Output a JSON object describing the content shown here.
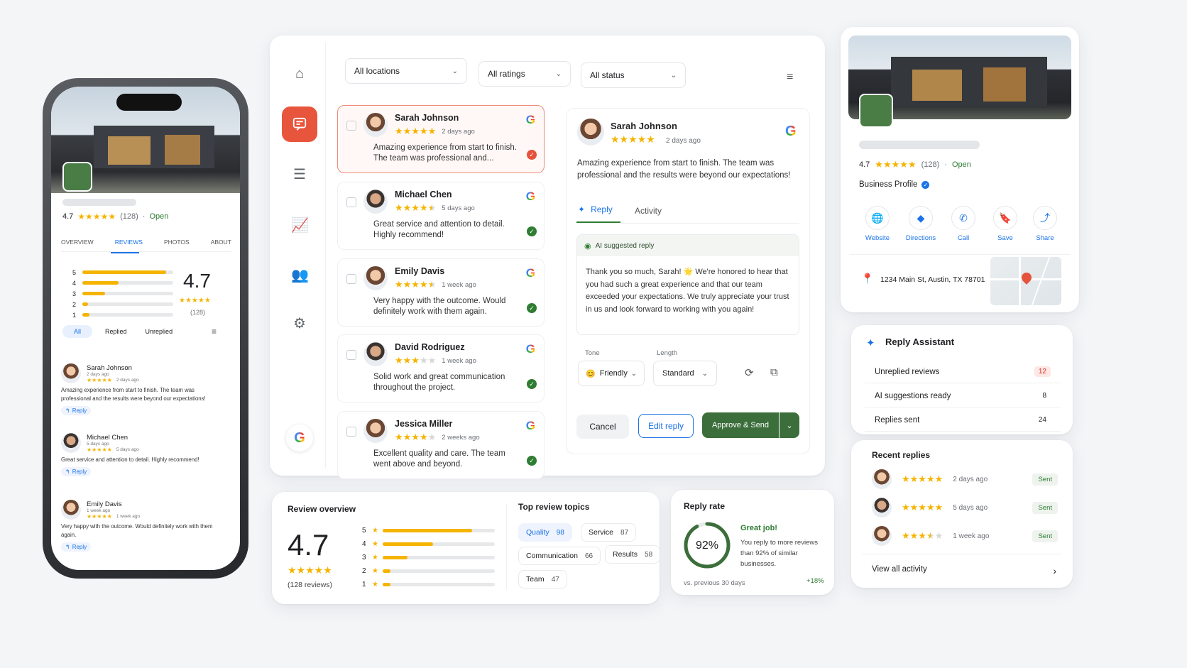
{
  "phone": {
    "rating": "4.7",
    "count": "(128)",
    "open": "Open",
    "tabs": [
      "OVERVIEW",
      "REVIEWS",
      "PHOTOS",
      "ABOUT"
    ],
    "dist": [
      {
        "label": "5",
        "pct": 0.92
      },
      {
        "label": "4",
        "pct": 0.4
      },
      {
        "label": "3",
        "pct": 0.25
      },
      {
        "label": "2",
        "pct": 0.06
      },
      {
        "label": "1",
        "pct": 0.08
      }
    ],
    "big_rating": "4.7",
    "big_count": "(128)",
    "filters": [
      "All",
      "Replied",
      "Unreplied"
    ],
    "reviews": [
      {
        "name": "Sarah Johnson",
        "sub": "2 days ago",
        "when": "2 days ago",
        "text": "Amazing experience from start to finish. The team was professional and the results were beyond our expectations!",
        "reply": "Reply"
      },
      {
        "name": "Michael Chen",
        "sub": "5 days ago",
        "when": "5 days ago",
        "text": "Great service and attention to detail. Highly recommend!",
        "reply": "Reply"
      },
      {
        "name": "Emily Davis",
        "sub": "1 week ago",
        "when": "1 week ago",
        "text": "Very happy with the outcome. Would definitely work with them again.",
        "reply": "Reply"
      }
    ]
  },
  "filters": {
    "locations": "All locations",
    "ratings": "All ratings",
    "status": "All status"
  },
  "reviews": [
    {
      "name": "Sarah Johnson",
      "when": "2 days ago",
      "stars": 5,
      "text": "Amazing experience from start to finish. The team was professional and...",
      "status": "unreplied"
    },
    {
      "name": "Michael Chen",
      "when": "5 days ago",
      "stars": 4.5,
      "text": "Great service and attention to detail. Highly recommend!",
      "status": "replied"
    },
    {
      "name": "Emily Davis",
      "when": "1 week ago",
      "stars": 4.5,
      "text": "Very happy with the outcome. Would definitely work with them again.",
      "status": "replied"
    },
    {
      "name": "David Rodriguez",
      "when": "1 week ago",
      "stars": 3,
      "text": "Solid work and great communication throughout the project.",
      "status": "replied"
    },
    {
      "name": "Jessica Miller",
      "when": "2 weeks ago",
      "stars": 4,
      "text": "Excellent quality and care. The team went above and beyond.",
      "status": "replied"
    }
  ],
  "detail": {
    "name": "Sarah Johnson",
    "when": "2 days ago",
    "text": "Amazing experience from start to finish. The team was professional and the results were beyond our expectations!",
    "tab_reply": "Reply",
    "tab_activity": "Activity",
    "ai_label": "AI suggested reply",
    "ai_text": "Thank you so much, Sarah! 🌟 We're honored to hear that you had such a great experience and that our team exceeded your expectations. We truly appreciate your trust in us and look forward to working with you again!",
    "tone_label": "Tone",
    "tone_value": "Friendly",
    "length_label": "Length",
    "length_value": "Standard",
    "cancel": "Cancel",
    "edit": "Edit reply",
    "approve": "Approve & Send"
  },
  "business": {
    "rating": "4.7",
    "count": "(128)",
    "open": "Open",
    "profile": "Business Profile",
    "actions": [
      "Website",
      "Directions",
      "Call",
      "Save",
      "Share"
    ],
    "address": "1234 Main St, Austin, TX 78701"
  },
  "assistant": {
    "title": "Reply Assistant",
    "items": [
      {
        "label": "Unreplied reviews",
        "value": "12"
      },
      {
        "label": "AI suggestions ready",
        "value": "8"
      },
      {
        "label": "Replies sent",
        "value": "24"
      }
    ],
    "recent_title": "Recent replies",
    "recent": [
      {
        "when": "2 days ago",
        "status": "Sent"
      },
      {
        "when": "5 days ago",
        "status": "Sent"
      },
      {
        "when": "1 week ago",
        "status": "Sent"
      }
    ],
    "view_all": "View all activity"
  },
  "overview": {
    "title": "Review overview",
    "rating": "4.7",
    "count": "(128 reviews)",
    "dist": [
      {
        "label": "5",
        "pct": 0.8
      },
      {
        "label": "4",
        "pct": 0.45
      },
      {
        "label": "3",
        "pct": 0.22
      },
      {
        "label": "2",
        "pct": 0.07
      },
      {
        "label": "1",
        "pct": 0.07
      }
    ]
  },
  "topics": {
    "title": "Top review topics",
    "items": [
      {
        "label": "Quality",
        "value": "98"
      },
      {
        "label": "Service",
        "value": "87"
      },
      {
        "label": "Communication",
        "value": "66"
      },
      {
        "label": "Results",
        "value": "58"
      },
      {
        "label": "Team",
        "value": "47"
      }
    ]
  },
  "reply_rate": {
    "title": "Reply rate",
    "pct": "92%",
    "pct_value": 0.92,
    "headline": "Great job!",
    "text": "You reply to more reviews than 92% of similar businesses.",
    "footer": "vs. previous 30 days",
    "delta": "+18%"
  },
  "colors": {
    "accent": "#e8553d",
    "green": "#3b6e3b",
    "blue": "#1a73e8",
    "star": "#f5b400"
  }
}
